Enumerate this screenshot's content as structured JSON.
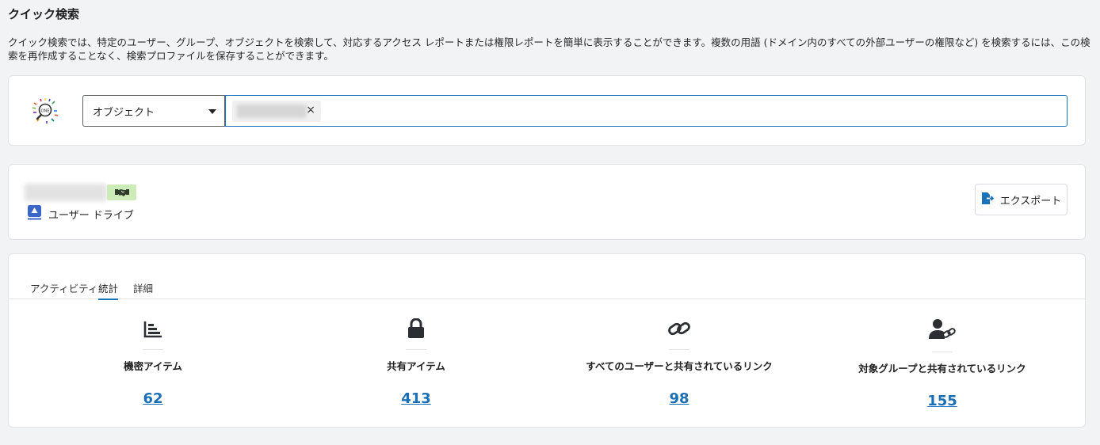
{
  "page": {
    "title": "クイック検索",
    "description": "クイック検索では、特定のユーザー、グループ、オブジェクトを検索して、対応するアクセス レポートまたは権限レポートを簡単に表示することができます。複数の用語 (ドメイン内のすべての外部ユーザーの権限など) を検索するには、この検索を再作成することなく、検索プロファイルを保存することができます。"
  },
  "search": {
    "logo_icon": "magnifier-logo-icon",
    "type_value": "オブジェクト",
    "chip_remove": "×"
  },
  "object": {
    "badge_icon": "handshake-icon",
    "badge_color": "#cdebb9",
    "drive_icon": "google-drive-icon",
    "drive_label": "ユーザー ドライブ",
    "export_label": "エクスポート",
    "export_icon": "export-file-icon"
  },
  "tabs": [
    {
      "label": "アクティビティ",
      "active": false
    },
    {
      "label": "統計",
      "active": true
    },
    {
      "label": "詳細",
      "active": false
    }
  ],
  "stats": [
    {
      "icon": "bar-chart-icon",
      "label": "機密アイテム",
      "value": "62"
    },
    {
      "icon": "lock-icon",
      "label": "共有アイテム",
      "value": "413"
    },
    {
      "icon": "link-icon",
      "label": "すべてのユーザーと共有されているリンク",
      "value": "98"
    },
    {
      "icon": "user-link-icon",
      "label": "対象グループと共有されているリンク",
      "value": "155"
    }
  ],
  "colors": {
    "accent": "#1a73b8",
    "link": "#1a6fb5",
    "background": "#f2f3f5"
  }
}
